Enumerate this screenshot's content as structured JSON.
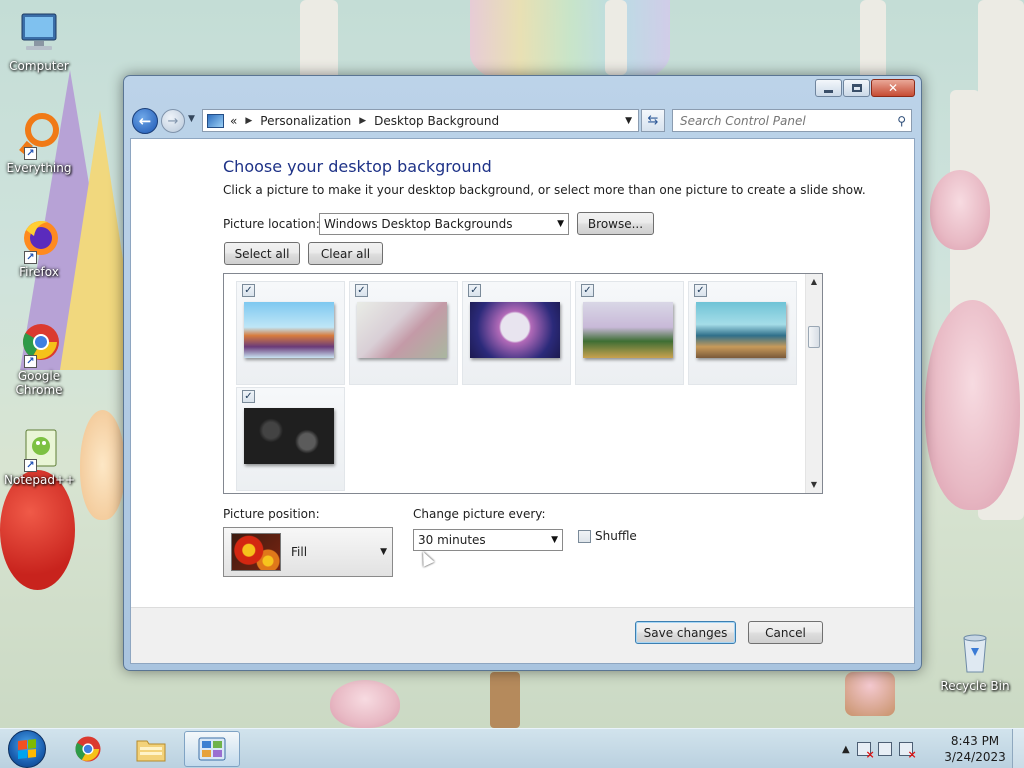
{
  "desktop": {
    "icons": [
      {
        "label": "Computer",
        "icon": "computer-icon"
      },
      {
        "label": "Everything",
        "icon": "everything-icon"
      },
      {
        "label": "Firefox",
        "icon": "firefox-icon"
      },
      {
        "label": "Google Chrome",
        "icon": "chrome-icon"
      },
      {
        "label": "Notepad++",
        "icon": "notepadpp-icon"
      },
      {
        "label": "Recycle Bin",
        "icon": "recycle-bin-icon"
      }
    ]
  },
  "window": {
    "breadcrumb": {
      "prefix": "«",
      "items": [
        "Personalization",
        "Desktop Background"
      ]
    },
    "search_placeholder": "Search Control Panel",
    "title": "Choose your desktop background",
    "subtitle": "Click a picture to make it your desktop background, or select more than one picture to create a slide show.",
    "picture_location": {
      "label": "Picture location:",
      "value": "Windows Desktop Backgrounds",
      "browse_label": "Browse..."
    },
    "select_all_label": "Select all",
    "clear_all_label": "Clear all",
    "thumbnails": [
      {
        "name": "wallpaper-1",
        "checked": true
      },
      {
        "name": "wallpaper-2",
        "checked": true
      },
      {
        "name": "wallpaper-3",
        "checked": true
      },
      {
        "name": "wallpaper-4",
        "checked": true
      },
      {
        "name": "wallpaper-5",
        "checked": true
      },
      {
        "name": "wallpaper-6",
        "checked": true
      }
    ],
    "picture_position": {
      "label": "Picture position:",
      "value": "Fill"
    },
    "change_picture": {
      "label": "Change picture every:",
      "value": "30 minutes"
    },
    "shuffle": {
      "label": "Shuffle",
      "checked": false
    },
    "save_label": "Save changes",
    "cancel_label": "Cancel"
  },
  "taskbar": {
    "apps": [
      "chrome-icon",
      "explorer-icon",
      "control-panel-icon"
    ],
    "clock": {
      "time": "8:43 PM",
      "date": "3/24/2023"
    }
  },
  "colors": {
    "title_blue": "#1e3287",
    "window_frame": "#a9c4df"
  }
}
